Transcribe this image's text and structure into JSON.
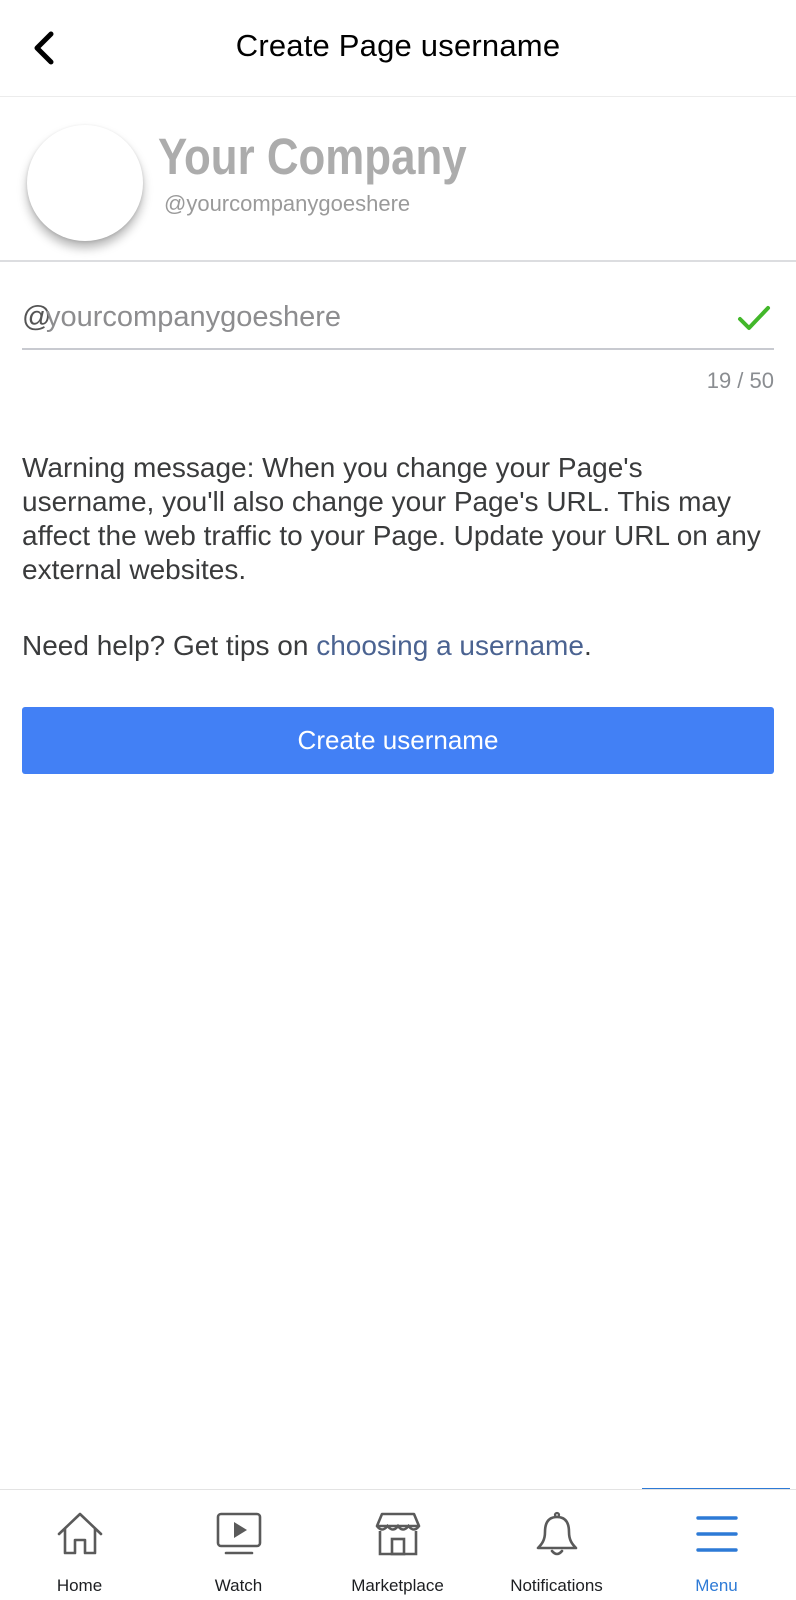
{
  "header": {
    "title": "Create Page username",
    "back_icon": "chevron-left-icon"
  },
  "profile": {
    "company_name": "Your Company",
    "handle": "@yourcompanygoeshere"
  },
  "username_field": {
    "prefix": "@",
    "value": "yourcompanygoeshere",
    "valid_icon": "checkmark-icon",
    "char_count": "19 / 50"
  },
  "warning_text": "Warning message: When you change your Page's username, you'll also change your Page's URL. This may affect the web traffic to your Page. Update your URL on any external websites.",
  "help": {
    "prefix": "Need help? Get tips on ",
    "link": "choosing a username",
    "suffix": "."
  },
  "create_button": {
    "label": "Create username"
  },
  "tabbar": {
    "tabs": [
      {
        "label": "Home",
        "icon": "home-icon",
        "active": false
      },
      {
        "label": "Watch",
        "icon": "watch-icon",
        "active": false
      },
      {
        "label": "Marketplace",
        "icon": "marketplace-icon",
        "active": false
      },
      {
        "label": "Notifications",
        "icon": "bell-icon",
        "active": false
      },
      {
        "label": "Menu",
        "icon": "menu-icon",
        "active": true
      }
    ]
  },
  "colors": {
    "accent": "#4280f5",
    "check": "#42b72a",
    "link": "#4b6391",
    "active_tab": "#2d7ad6"
  }
}
